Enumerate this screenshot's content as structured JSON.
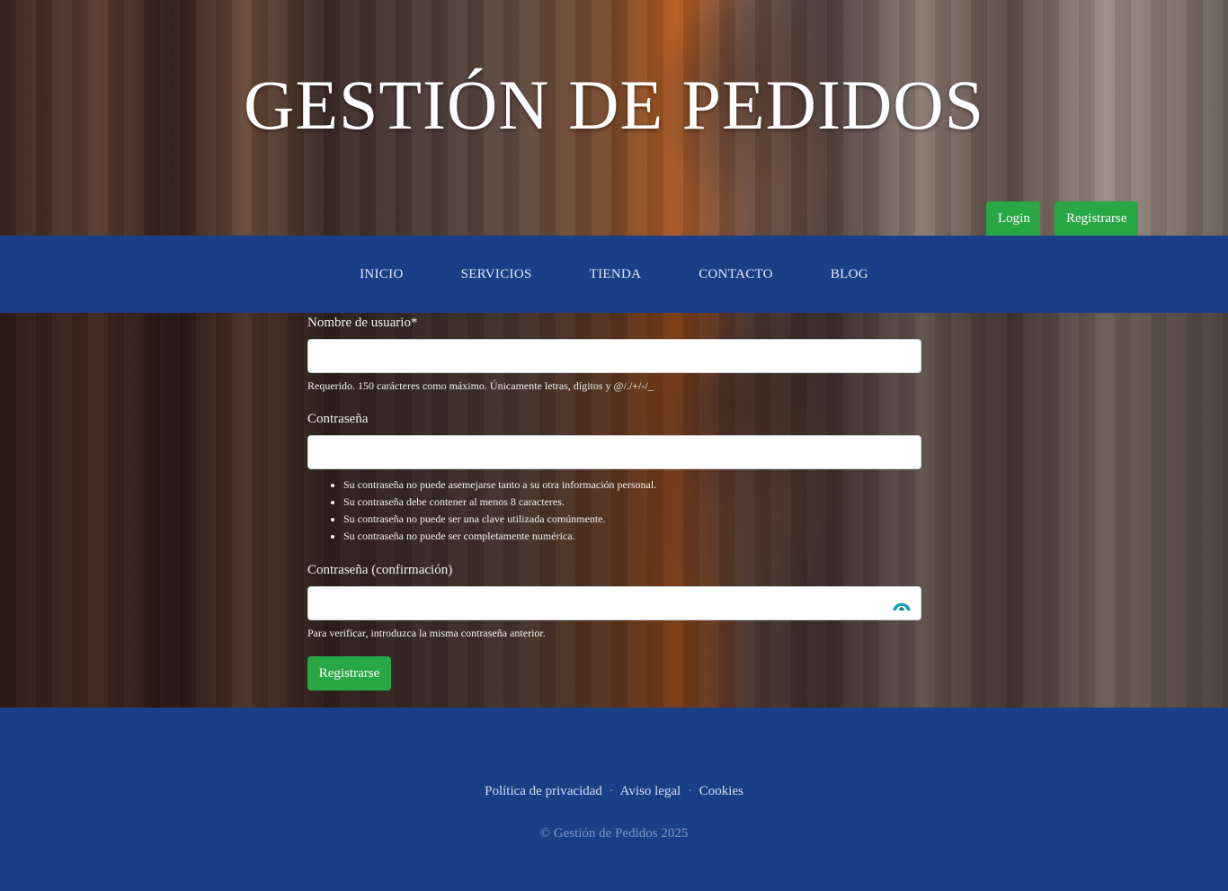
{
  "header": {
    "site_title": "GESTIÓN DE PEDIDOS",
    "login_label": "Login",
    "signup_label": "Registrarse"
  },
  "nav": {
    "items": [
      "INICIO",
      "SERVICIOS",
      "TIENDA",
      "CONTACTO",
      "BLOG"
    ]
  },
  "form": {
    "username_label": "Nombre de usuario*",
    "username_value": "",
    "username_help": "Requerido. 150 carácteres como máximo. Únicamente letras, dígitos y @/./+/-/_",
    "password_label": "Contraseña",
    "password_value": "",
    "password_rules": [
      "Su contraseña no puede asemejarse tanto a su otra información personal.",
      "Su contraseña debe contener al menos 8 caracteres.",
      "Su contraseña no puede ser una clave utilizada comúnmente.",
      "Su contraseña no puede ser completamente numérica."
    ],
    "confirm_label": "Contraseña (confirmación)",
    "confirm_value": "",
    "confirm_help": "Para verificar, introduzca la misma contraseña anterior.",
    "submit_label": "Registrarse"
  },
  "footer": {
    "links": [
      "Política de privacidad",
      "Aviso legal",
      "Cookies"
    ],
    "separator": "·",
    "copyright": "© Gestión de Pedidos 2025"
  },
  "colors": {
    "brand_blue": "#1a3f87",
    "button_green": "#28a745",
    "eye_icon": "#17a2b8"
  },
  "icons": {
    "password_toggle": "eye-icon"
  }
}
